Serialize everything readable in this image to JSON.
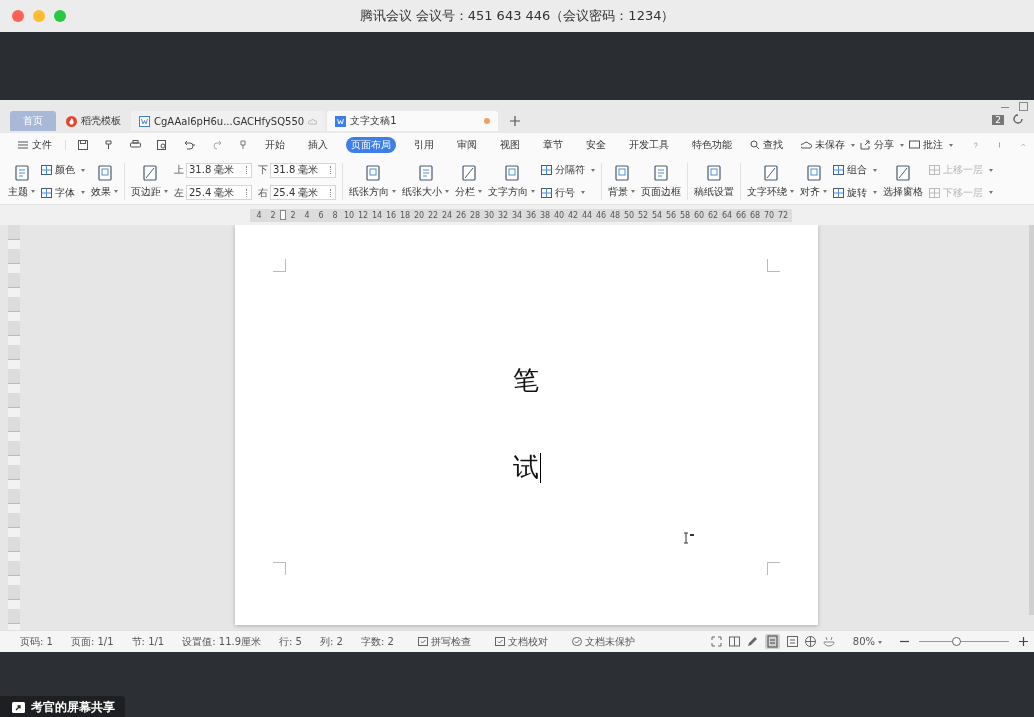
{
  "window": {
    "title": "腾讯会议 会议号：451 643 446（会议密码：1234）"
  },
  "tabs": [
    {
      "label": "首页",
      "kind": "home",
      "selected": false
    },
    {
      "label": "稻壳模板",
      "kind": "docer",
      "selected": false
    },
    {
      "label": "CgAAal6pH6u...GACHfySQ550",
      "kind": "doc",
      "selected": false
    },
    {
      "label": "文字文稿1",
      "kind": "doc",
      "selected": true
    }
  ],
  "window_badge": "2",
  "menu": {
    "file": "文件",
    "items": [
      {
        "label": "开始",
        "selected": false
      },
      {
        "label": "插入",
        "selected": false
      },
      {
        "label": "页面布局",
        "selected": true
      },
      {
        "label": "引用",
        "selected": false
      },
      {
        "label": "审阅",
        "selected": false
      },
      {
        "label": "视图",
        "selected": false
      },
      {
        "label": "章节",
        "selected": false
      },
      {
        "label": "安全",
        "selected": false
      },
      {
        "label": "开发工具",
        "selected": false
      },
      {
        "label": "特色功能",
        "selected": false
      }
    ],
    "search": "查找",
    "actions": [
      {
        "label": "未保存"
      },
      {
        "label": "分享"
      },
      {
        "label": "批注"
      }
    ]
  },
  "ribbon": [
    {
      "kind": "large",
      "label": "主题",
      "dropdown": true
    },
    {
      "kind": "stack",
      "items": [
        {
          "label": "颜色",
          "dropdown": true,
          "disabled": false
        },
        {
          "label": "字体",
          "dropdown": true,
          "disabled": false
        }
      ]
    },
    {
      "kind": "large",
      "label": "效果",
      "dropdown": true
    },
    {
      "kind": "sep"
    },
    {
      "kind": "large",
      "label": "页边距",
      "dropdown": true
    },
    {
      "kind": "fields",
      "items": [
        {
          "label": "上",
          "value": "31.8 毫米"
        },
        {
          "label": "左",
          "value": "25.4 毫米"
        }
      ]
    },
    {
      "kind": "fields",
      "items": [
        {
          "label": "下",
          "value": "31.8 毫米"
        },
        {
          "label": "右",
          "value": "25.4 毫米"
        }
      ]
    },
    {
      "kind": "sep"
    },
    {
      "kind": "large",
      "label": "纸张方向",
      "dropdown": true
    },
    {
      "kind": "large",
      "label": "纸张大小",
      "dropdown": true
    },
    {
      "kind": "large",
      "label": "分栏",
      "dropdown": true
    },
    {
      "kind": "large",
      "label": "文字方向",
      "dropdown": true
    },
    {
      "kind": "stack",
      "items": [
        {
          "label": "分隔符",
          "dropdown": true,
          "disabled": false
        },
        {
          "label": "行号",
          "dropdown": true,
          "disabled": false
        }
      ]
    },
    {
      "kind": "sep"
    },
    {
      "kind": "large",
      "label": "背景",
      "dropdown": true
    },
    {
      "kind": "large",
      "label": "页面边框",
      "dropdown": false
    },
    {
      "kind": "sep"
    },
    {
      "kind": "large",
      "label": "稿纸设置",
      "dropdown": false
    },
    {
      "kind": "sep"
    },
    {
      "kind": "large",
      "label": "文字环绕",
      "dropdown": true
    },
    {
      "kind": "large",
      "label": "对齐",
      "dropdown": true
    },
    {
      "kind": "stack",
      "items": [
        {
          "label": "组合",
          "dropdown": true,
          "disabled": false
        },
        {
          "label": "旋转",
          "dropdown": true,
          "disabled": false
        }
      ]
    },
    {
      "kind": "large",
      "label": "选择窗格",
      "dropdown": false
    },
    {
      "kind": "stack",
      "items": [
        {
          "label": "上移一层",
          "dropdown": true,
          "disabled": true
        },
        {
          "label": "下移一层",
          "dropdown": true,
          "disabled": true
        }
      ]
    }
  ],
  "ruler": [
    "4",
    "2",
    "2",
    "4",
    "6",
    "8",
    "10",
    "12",
    "14",
    "16",
    "18",
    "20",
    "22",
    "24",
    "26",
    "28",
    "30",
    "32",
    "34",
    "36",
    "38",
    "40",
    "42",
    "44",
    "46",
    "48",
    "50",
    "52",
    "54",
    "56",
    "58",
    "60",
    "62",
    "64",
    "66",
    "68",
    "70",
    "72"
  ],
  "document": {
    "lines": [
      "笔",
      "试"
    ]
  },
  "status_bar": {
    "items": [
      {
        "kind": "text",
        "label": "页码: 1"
      },
      {
        "kind": "text",
        "label": "页面: 1/1"
      },
      {
        "kind": "text",
        "label": "节: 1/1"
      },
      {
        "kind": "text",
        "label": "设置值: 11.9厘米"
      },
      {
        "kind": "text",
        "label": "行: 5"
      },
      {
        "kind": "text",
        "label": "列: 2"
      },
      {
        "kind": "text",
        "label": "字数: 2"
      },
      {
        "kind": "button",
        "label": "拼写检查"
      },
      {
        "kind": "button",
        "label": "文档校对"
      },
      {
        "kind": "button",
        "label": "文档未保护"
      }
    ],
    "zoom": "80%",
    "zoom_level": {
      "level": 0.42
    }
  },
  "share_badge": "考官的屏幕共享"
}
